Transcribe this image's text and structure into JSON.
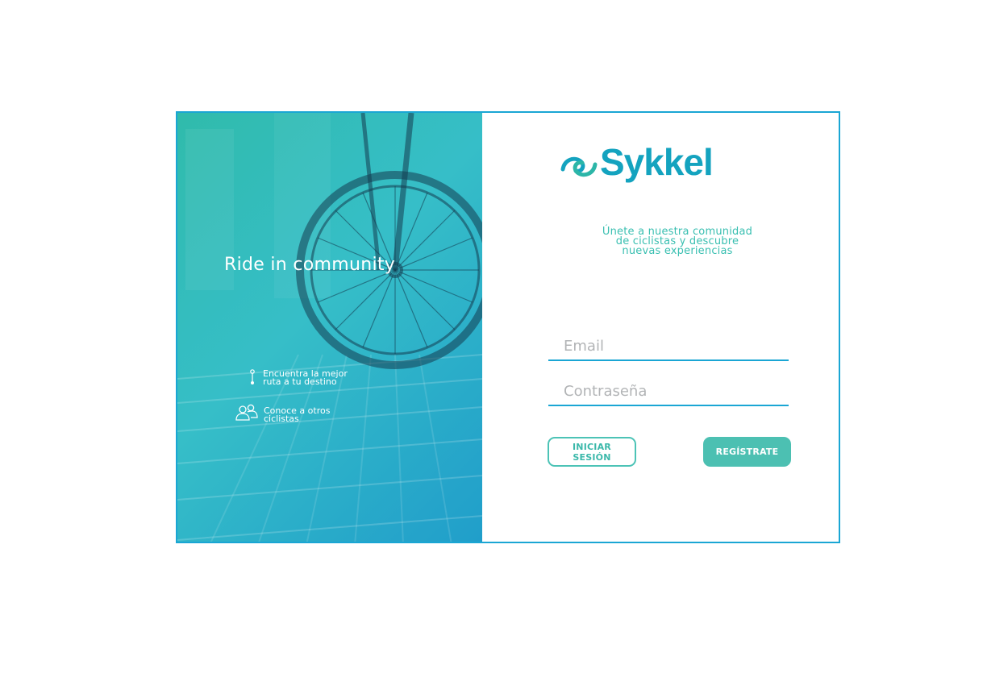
{
  "hero": {
    "title": "Ride in community",
    "features": [
      {
        "icon": "route-pin-icon",
        "lines": [
          "Encuentra la mejor",
          "ruta a tu destino"
        ]
      },
      {
        "icon": "users-icon",
        "lines": [
          "Conoce a otros",
          "ciclistas"
        ]
      }
    ]
  },
  "brand": {
    "name": "Sykkel",
    "logo_icon": "swirl-logo-icon",
    "color": "#14a3bf"
  },
  "tagline": [
    "Únete a nuestra comunidad",
    "de ciclistas y descubre",
    "nuevas experiencias"
  ],
  "form": {
    "email": {
      "placeholder": "Email",
      "value": ""
    },
    "password": {
      "placeholder": "Contraseña",
      "value": ""
    }
  },
  "buttons": {
    "login": "INICIAR SESIÓN",
    "register": "REGÍSTRATE"
  },
  "colors": {
    "accent_blue": "#1aa6d4",
    "accent_teal": "#4cc0b2"
  }
}
